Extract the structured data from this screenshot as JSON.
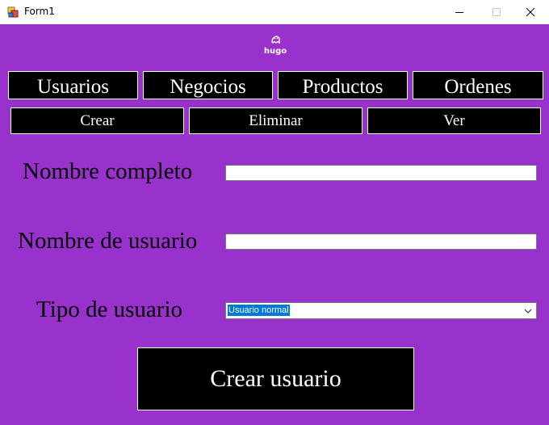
{
  "window": {
    "title": "Form1"
  },
  "logo": {
    "text": "hugo"
  },
  "nav": [
    {
      "label": "Usuarios"
    },
    {
      "label": "Negocios"
    },
    {
      "label": "Productos"
    },
    {
      "label": "Ordenes"
    }
  ],
  "subnav": [
    {
      "label": "Crear"
    },
    {
      "label": "Eliminar"
    },
    {
      "label": "Ver"
    }
  ],
  "form": {
    "full_name_label": "Nombre completo",
    "full_name_value": "",
    "username_label": "Nombre de usuario",
    "username_value": "",
    "user_type_label": "Tipo de usuario",
    "user_type_value": "Usuario normal",
    "submit_label": "Crear usuario"
  },
  "colors": {
    "background": "#9932cc",
    "button": "#000000",
    "button_text": "#ffffff",
    "selection": "#0078d7"
  }
}
